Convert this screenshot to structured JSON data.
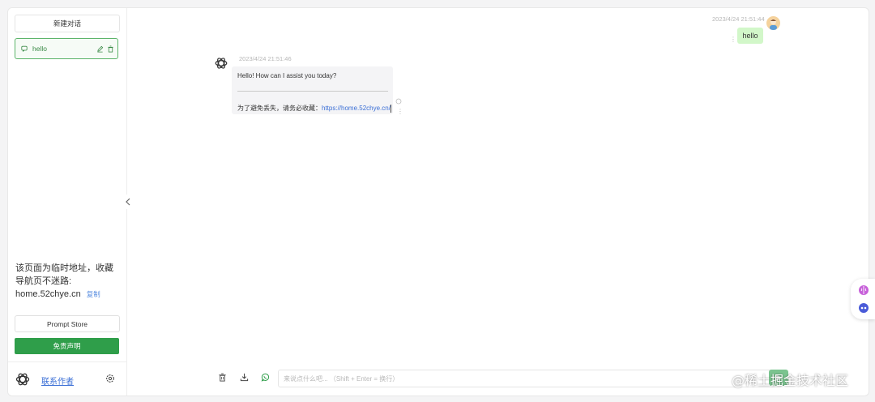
{
  "sidebar": {
    "new_chat_label": "新建对话",
    "conversations": [
      {
        "title": "hello"
      }
    ],
    "notice": {
      "text": "该页面为临时地址，收藏导航页不迷路:",
      "domain": "home.52chye.cn",
      "copy_label": "复制"
    },
    "prompt_store_label": "Prompt Store",
    "disclaimer_label": "免责声明",
    "contact_label": "联系作者"
  },
  "chat": {
    "messages": [
      {
        "role": "user",
        "time": "2023/4/24 21:51:44",
        "text": "hello"
      },
      {
        "role": "assistant",
        "time": "2023/4/24 21:51:46",
        "text": "Hello! How can I assist you today?",
        "footer_text": "为了避免丢失，请务必收藏：",
        "footer_link": "https://home.52chye.cn/"
      }
    ]
  },
  "input": {
    "placeholder": "来说点什么吧... （Shift + Enter = 换行）",
    "value": ""
  },
  "watermark": "@稀土掘金技术社区",
  "icons": {
    "sidebar": [
      "chat-icon",
      "edit-icon",
      "trash-icon",
      "openai-logo-icon",
      "gear-icon",
      "chevron-left-icon"
    ],
    "toolbar": [
      "trash-icon",
      "download-icon",
      "whatsapp-icon",
      "send-icon"
    ],
    "floating": [
      "brain-icon",
      "robot-icon"
    ]
  },
  "colors": {
    "accent": "#2f9e4a",
    "user_bubble": "#d2f7c9",
    "link": "#3b6fd6"
  }
}
